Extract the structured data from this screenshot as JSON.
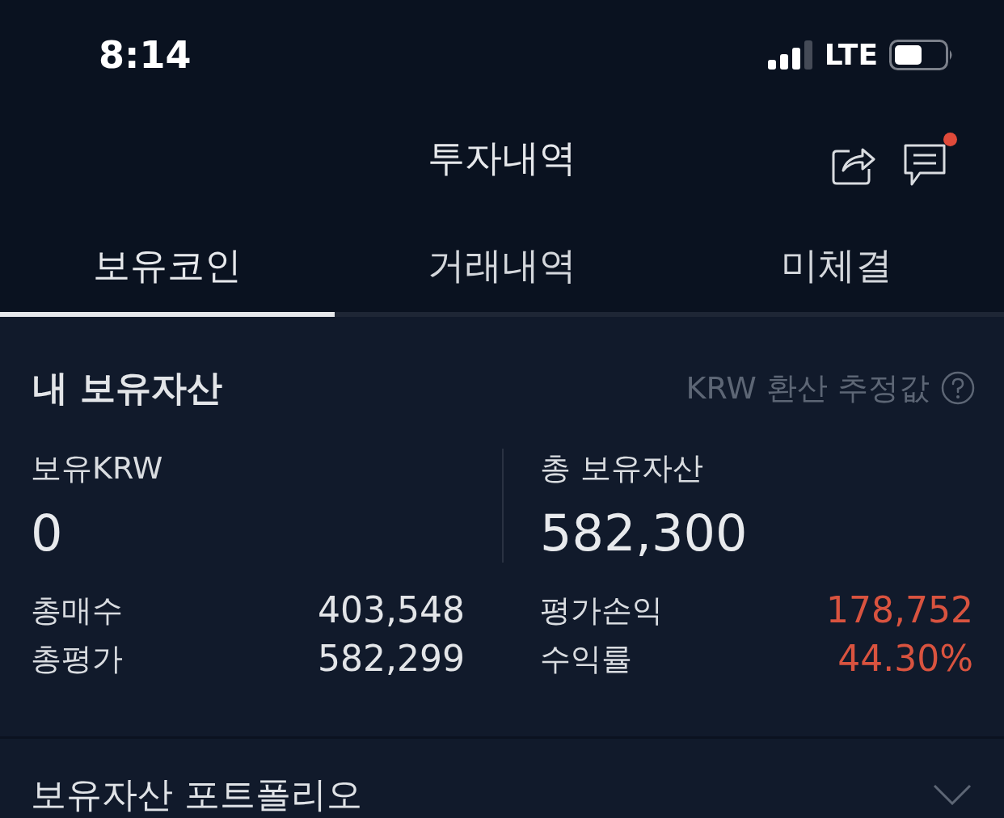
{
  "status_bar": {
    "time": "8:14",
    "network": "LTE"
  },
  "header": {
    "title": "투자내역",
    "notification": true
  },
  "tabs": [
    {
      "label": "보유코인",
      "selected": true
    },
    {
      "label": "거래내역",
      "selected": false
    },
    {
      "label": "미체결",
      "selected": false
    }
  ],
  "holdings": {
    "title": "내 보유자산",
    "note": "KRW 환산 추정값",
    "krw": {
      "label": "보유KRW",
      "value": "0"
    },
    "total": {
      "label": "총 보유자산",
      "value": "582,300"
    },
    "left_rows": [
      {
        "label": "총매수",
        "value": "403,548"
      },
      {
        "label": "총평가",
        "value": "582,299"
      }
    ],
    "right_rows": [
      {
        "label": "평가손익",
        "value": "178,752",
        "gain": true
      },
      {
        "label": "수익률",
        "value": "44.30%",
        "gain": true
      }
    ]
  },
  "portfolio": {
    "title": "보유자산 포트폴리오",
    "expanded": false
  }
}
